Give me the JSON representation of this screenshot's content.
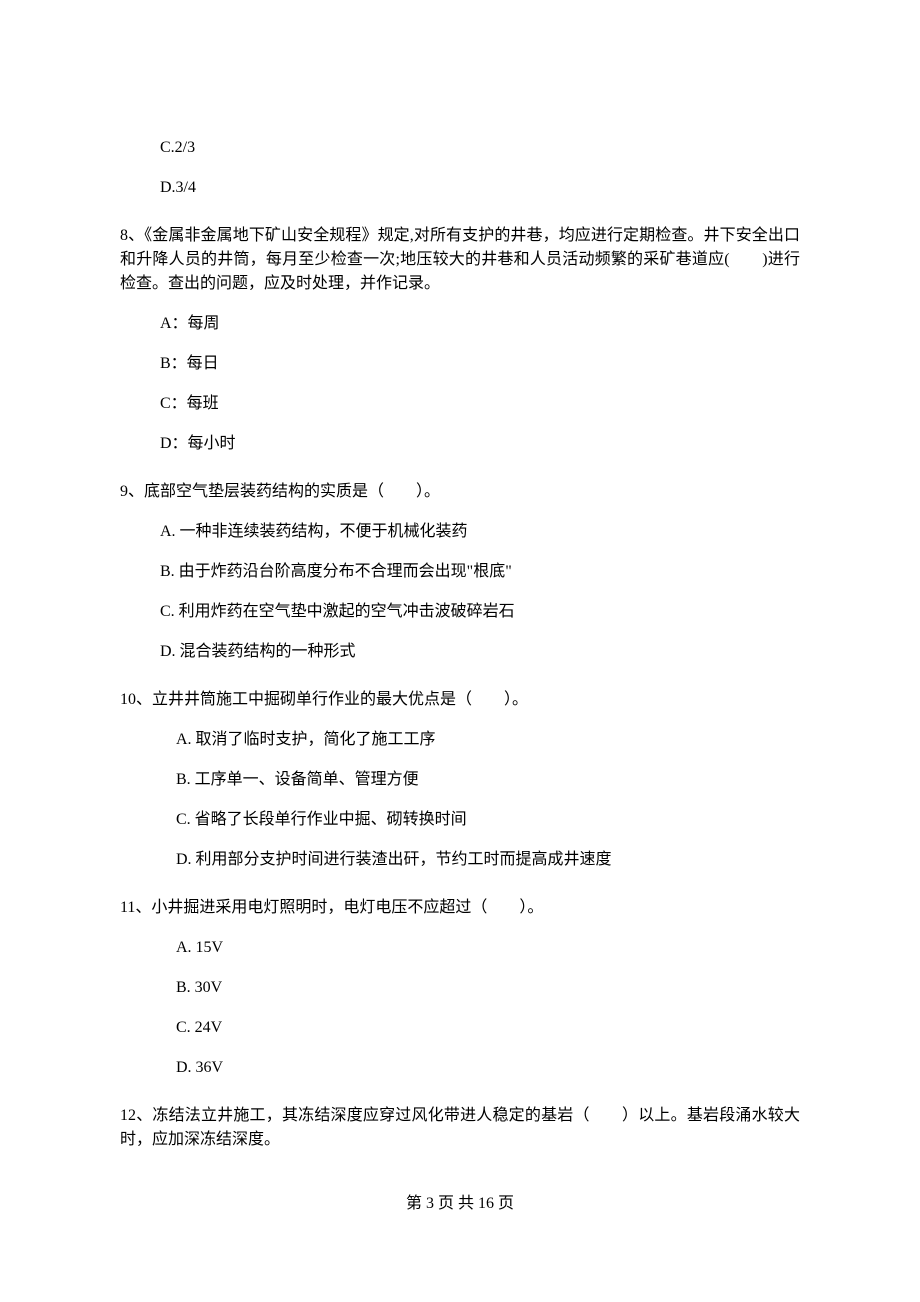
{
  "q7_options": {
    "c": "C.2/3",
    "d": "D.3/4"
  },
  "q8": {
    "text": "8、《金属非金属地下矿山安全规程》规定,对所有支护的井巷，均应进行定期检查。井下安全出口和升降人员的井筒，每月至少检查一次;地压较大的井巷和人员活动频繁的采矿巷道应(　　)进行检查。查出的问题，应及时处理，并作记录。",
    "options": {
      "a": "A：每周",
      "b": "B：每日",
      "c": "C：每班",
      "d": "D：每小时"
    }
  },
  "q9": {
    "text": "9、底部空气垫层装药结构的实质是（　　）。",
    "options": {
      "a": "A.  一种非连续装药结构，不便于机械化装药",
      "b": "B.  由于炸药沿台阶高度分布不合理而会出现\"根底\"",
      "c": "C.  利用炸药在空气垫中激起的空气冲击波破碎岩石",
      "d": "D.  混合装药结构的一种形式"
    }
  },
  "q10": {
    "text": "10、立井井筒施工中掘砌单行作业的最大优点是（　　）。",
    "options": {
      "a": "A.  取消了临时支护，简化了施工工序",
      "b": "B.  工序单一、设备简单、管理方便",
      "c": "C.  省略了长段单行作业中掘、砌转换时间",
      "d": "D.  利用部分支护时间进行装渣出矸，节约工时而提高成井速度"
    }
  },
  "q11": {
    "text": "11、小井掘进采用电灯照明时，电灯电压不应超过（　　）。",
    "options": {
      "a": "A.  15V",
      "b": "B.  30V",
      "c": "C.  24V",
      "d": "D.  36V"
    }
  },
  "q12": {
    "text": "12、冻结法立井施工，其冻结深度应穿过风化带进人稳定的基岩（　　）以上。基岩段涌水较大时，应加深冻结深度。"
  },
  "footer": "第 3 页 共 16 页"
}
